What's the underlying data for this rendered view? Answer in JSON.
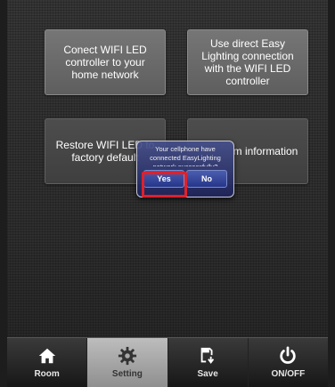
{
  "tiles": [
    {
      "label": "Conect WIFI LED controller to your home network"
    },
    {
      "label": "Use direct Easy Lighting connection with the WIFI LED controller"
    },
    {
      "label": "Restore WIFI LED to factory default"
    },
    {
      "label": "m information"
    }
  ],
  "dialog": {
    "message": "Your cellphone have connected EasyLighting network successfully?",
    "yes_label": "Yes",
    "no_label": "No"
  },
  "tabs": [
    {
      "label": "Room",
      "icon": "home-icon"
    },
    {
      "label": "Setting",
      "icon": "gear-icon",
      "active": true
    },
    {
      "label": "Save",
      "icon": "save-icon"
    },
    {
      "label": "ON/OFF",
      "icon": "power-icon"
    }
  ],
  "colors": {
    "highlight": "#e0202a",
    "dialog": "#26378a"
  }
}
